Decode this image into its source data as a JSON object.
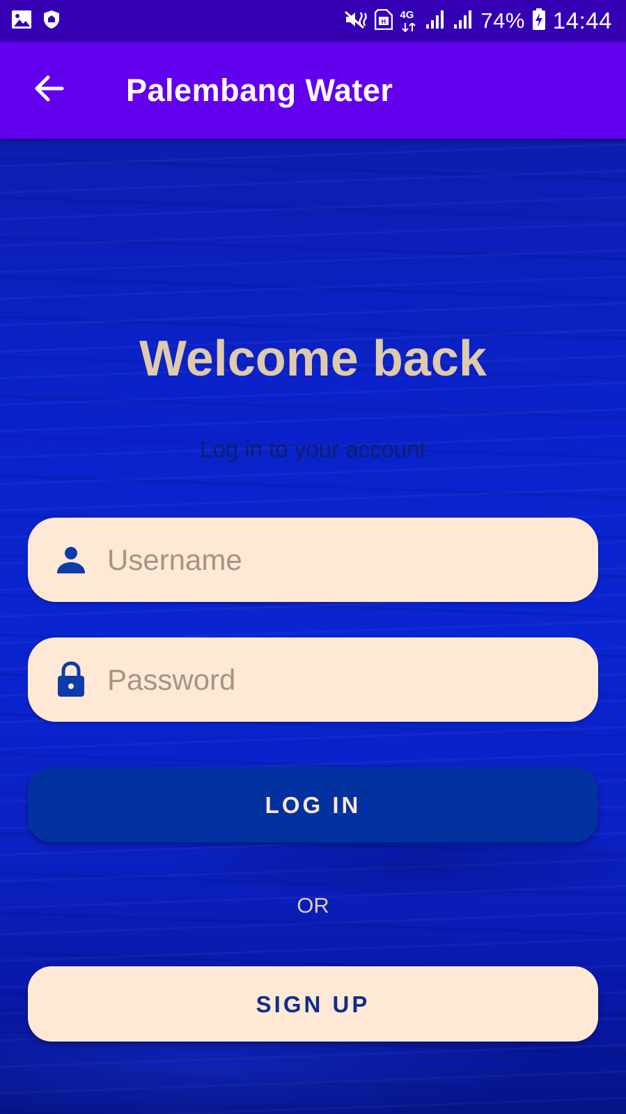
{
  "status_bar": {
    "left_icons": [
      "image-icon",
      "shield-icon"
    ],
    "right_icons": [
      "vibrate-mute-icon",
      "sim-icon",
      "network-4g-icon",
      "signal-icon",
      "signal-icon",
      "battery-charging-icon"
    ],
    "network_type": "4G",
    "battery_percent": "74%",
    "time": "14:44"
  },
  "app_bar": {
    "back_icon": "arrow-back-icon",
    "title": "Palembang Water"
  },
  "login": {
    "heading": "Welcome back",
    "subtitle": "Log in to your account",
    "username": {
      "icon": "person-icon",
      "placeholder": "Username",
      "value": ""
    },
    "password": {
      "icon": "lock-icon",
      "placeholder": "Password",
      "value": ""
    },
    "login_button": "LOG IN",
    "separator": "OR",
    "signup_button": "SIGN UP"
  },
  "colors": {
    "status_bar": "#3500b4",
    "app_bar": "#6200ee",
    "heading": "#dfcaab",
    "field_background": "#ffe9d4",
    "login_button": "#0231a0",
    "signup_text": "#0d2d8f",
    "icon_blue": "#0d3ba8"
  }
}
